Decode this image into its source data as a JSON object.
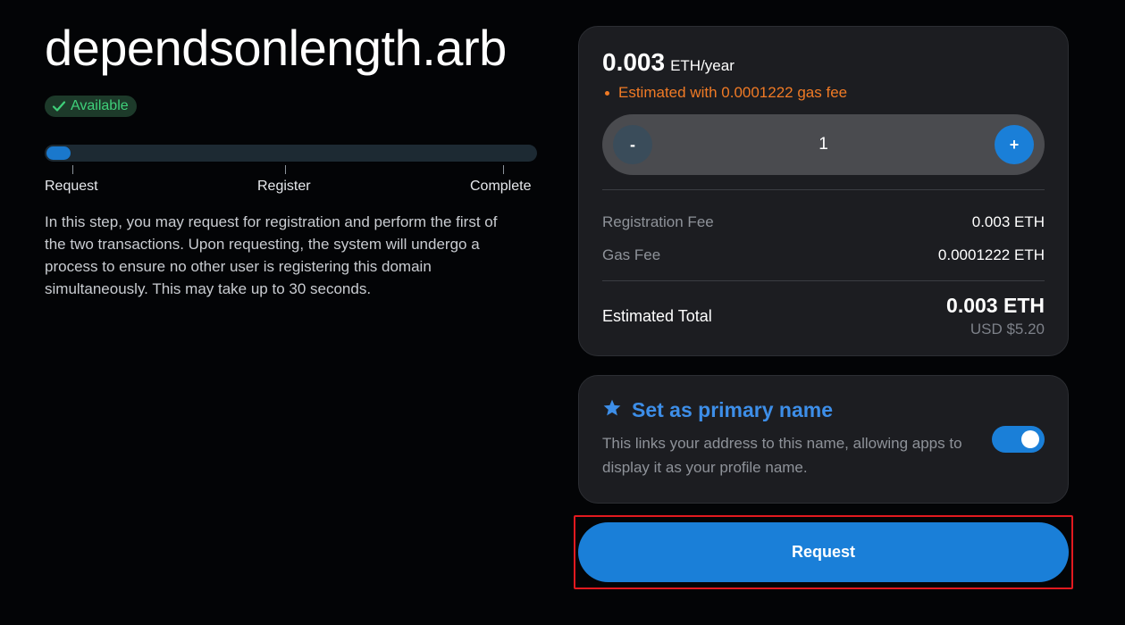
{
  "domain": {
    "name": "dependsonlength.arb",
    "status": "Available"
  },
  "progress": {
    "fraction": 0.05,
    "steps": [
      "Request",
      "Register",
      "Complete"
    ],
    "description": "In this step, you may request for registration and perform the first of the two transactions. Upon requesting, the system will undergo a process to ensure no other user is registering this domain simultaneously. This may take up to 30 seconds."
  },
  "pricing": {
    "amount": "0.003",
    "unit": "ETH/year",
    "estimate_note": "Estimated with 0.0001222 gas fee",
    "years": "1",
    "minus_label": "-",
    "plus_label": "+",
    "registration_fee_label": "Registration Fee",
    "registration_fee_value": "0.003 ETH",
    "gas_fee_label": "Gas Fee",
    "gas_fee_value": "0.0001222 ETH",
    "total_label": "Estimated Total",
    "total_eth": "0.003 ETH",
    "total_usd": "USD $5.20"
  },
  "primary_name": {
    "title": "Set as primary name",
    "description": "This links your address to this name, allowing apps to display it as your profile name.",
    "enabled": true
  },
  "actions": {
    "request_label": "Request"
  },
  "colors": {
    "accent": "#1a7fd8",
    "available_green": "#3fd07a",
    "warning_orange": "#f07a25",
    "highlight_red": "#e2191f"
  },
  "icons": {
    "available": "check-icon",
    "primary_name": "star-icon"
  }
}
